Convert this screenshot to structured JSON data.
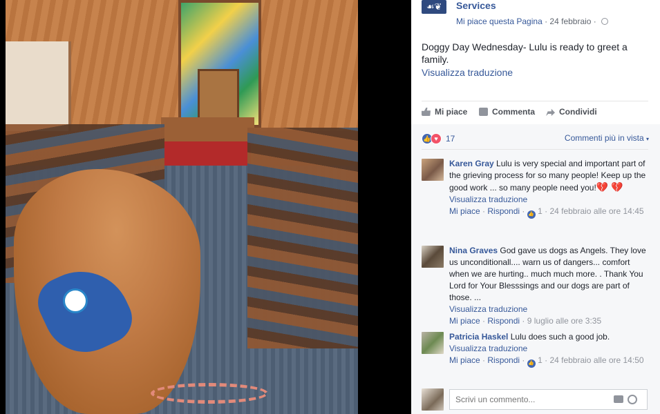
{
  "photo": {
    "alt_icons": [
      "dog",
      "service-vest",
      "leash"
    ]
  },
  "page": {
    "name": "Services",
    "like_label": "Mi piace questa Pagina",
    "separator": " · ",
    "date": "24 febbraio",
    "privacy_icon": "globe-icon"
  },
  "post": {
    "text": "Doggy Day Wednesday- Lulu is ready to greet a family.",
    "translation_link": "Visualizza traduzione"
  },
  "actions": {
    "like": "Mi piace",
    "comment": "Commenta",
    "share": "Condividi"
  },
  "reactions": {
    "count": "17",
    "sort_label": "Commenti più in vista"
  },
  "comments": [
    {
      "author": "Karen Gray",
      "text": "Lulu is very special and important part of the grieving process for so many people! Keep up the good work ... so many people need you!",
      "emoji": "💔 💔",
      "translation": "Visualizza traduzione",
      "like": "Mi piace",
      "reply": "Rispondi",
      "likes": "1",
      "time": "24 febbraio alle ore 14:45"
    },
    {
      "author": "Nina Graves",
      "text": "God gave us dogs as Angels. They love us unconditionall.... warn us of dangers... comfort when we are hurting.. much much more. . Thank You Lord for Your Blesssings and our dogs are part of those. ...",
      "translation": "Visualizza traduzione",
      "like": "Mi piace",
      "reply": "Rispondi",
      "time": "9 luglio alle ore 3:35"
    },
    {
      "author": "Patricia Haskel",
      "text": "Lulu does such a good job.",
      "translation": "Visualizza traduzione",
      "like": "Mi piace",
      "reply": "Rispondi",
      "likes": "1",
      "time": "24 febbraio alle ore 14:50"
    }
  ],
  "composer": {
    "placeholder": "Scrivi un commento..."
  },
  "colors": {
    "link": "#365899",
    "like_reaction": "#4267b2",
    "love_reaction": "#f25268"
  }
}
